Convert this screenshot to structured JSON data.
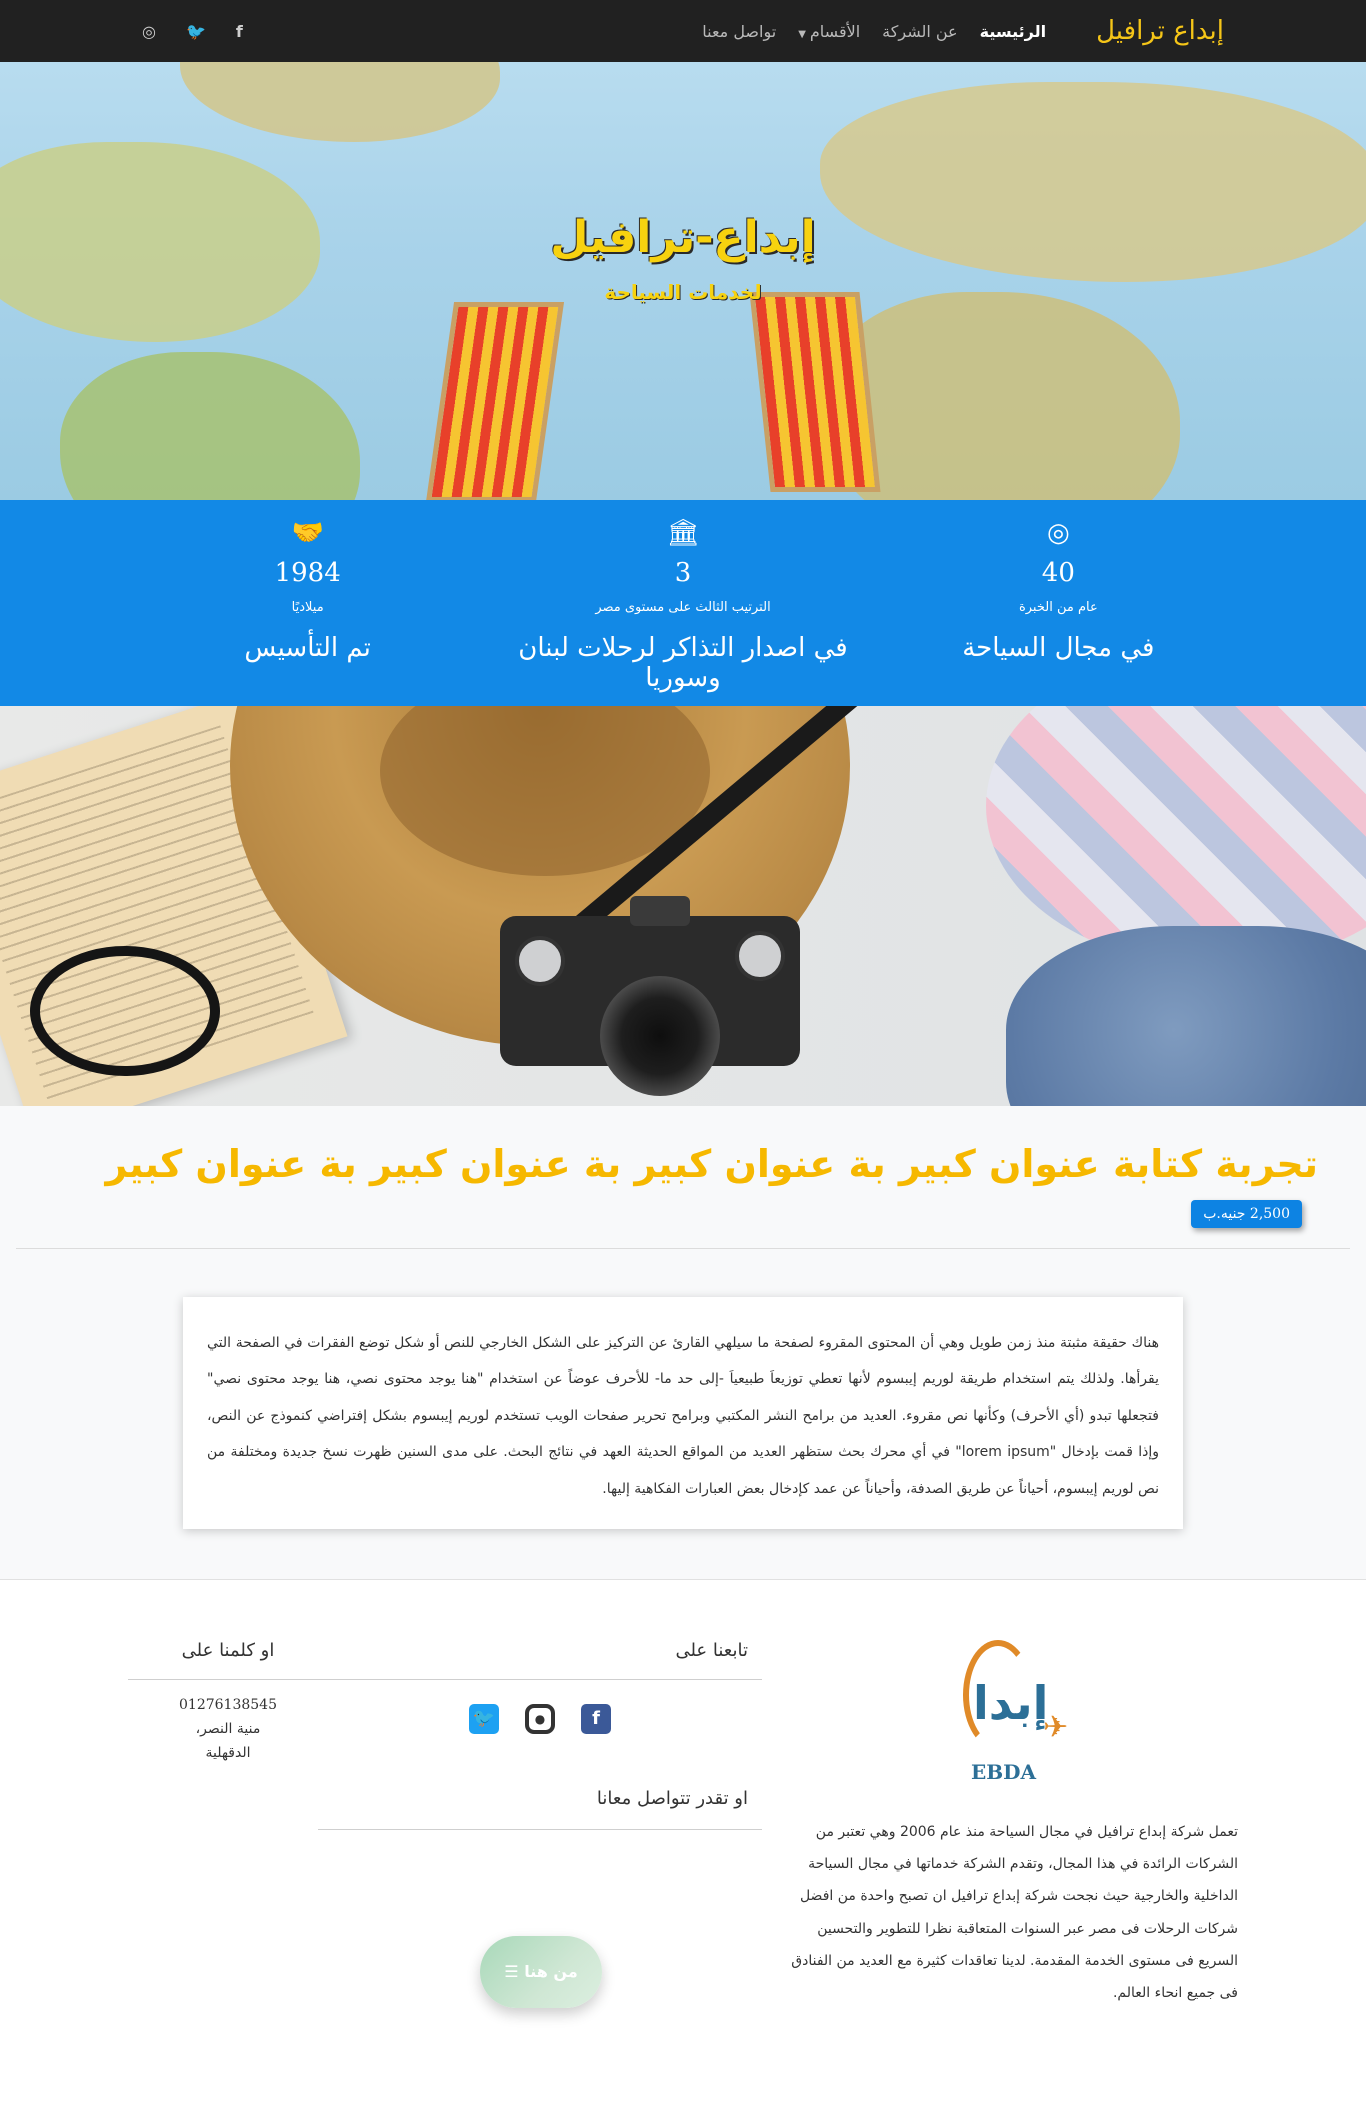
{
  "nav": {
    "brand": "إبداع ترافيل",
    "links": [
      "الرئيسية",
      "عن الشركة",
      "الأقسام",
      "تواصل معنا"
    ],
    "social": {
      "facebook": "f",
      "twitter": "🐦",
      "instagram": "◎"
    }
  },
  "hero": {
    "title": "إبداع-ترافيل",
    "subtitle": "لخدمات السياحة"
  },
  "stats": [
    {
      "icon": "target-icon",
      "number": "40",
      "small": "عام من الخبرة",
      "big": "في مجال السياحة"
    },
    {
      "icon": "bank-icon",
      "number": "3",
      "small": "الترتيب الثالث على مستوى مصر",
      "big": "في اصدار التذاكر لرحلات لبنان وسوريا"
    },
    {
      "icon": "handshake-icon",
      "number": "1984",
      "small": "ميلاديًا",
      "big": "تم التأسيس"
    }
  ],
  "article": {
    "title": "تجربة كتابة عنوان كبير بة عنوان كبير بة عنوان كبير بة عنوان كبير",
    "price": "2,500 جنيه.ب",
    "body": "هناك حقيقة مثبتة منذ زمن طويل وهي أن المحتوى المقروء لصفحة ما سيلهي القارئ عن التركيز على الشكل الخارجي للنص أو شكل توضع الفقرات في الصفحة التي يقرأها. ولذلك يتم استخدام طريقة لوريم إيبسوم لأنها تعطي توزيعاَ طبيعياَ -إلى حد ما- للأحرف عوضاً عن استخدام \"هنا يوجد محتوى نصي، هنا يوجد محتوى نصي\" فتجعلها تبدو (أي الأحرف) وكأنها نص مقروء. العديد من برامح النشر المكتبي وبرامح تحرير صفحات الويب تستخدم لوريم إيبسوم بشكل إفتراضي كنموذج عن النص، وإذا قمت بإدخال \"lorem ipsum\" في أي محرك بحث ستظهر العديد من المواقع الحديثة العهد في نتائج البحث. على مدى السنين ظهرت نسخ جديدة ومختلفة من نص لوريم إيبسوم، أحياناً عن طريق الصدفة، وأحياناً عن عمد كإدخال بعض العبارات الفكاهية إليها."
  },
  "footer": {
    "logo_text": "EBDA",
    "about": "تعمل شركة إبداع ترافيل في مجال السياحة منذ عام 2006 وهي تعتبر من الشركات الرائدة في هذا المجال، وتقدم الشركة خدماتها في مجال السياحة الداخلية والخارجية حيث نجحت شركة إبداع ترافيل ان تصبح واحدة من افضل شركات الرحلات فى مصر عبر السنوات المتعاقبة نظرا للتطوير والتحسين السريع فى مستوى الخدمة المقدمة. لدينا تعاقدات كثيرة مع العديد من الفنادق فى جميع انحاء العالم.",
    "follow_title": "تابعنا على",
    "contact_title": "او تقدر تتواصل معانا",
    "cta": "من هنا ☰",
    "call_title": "او كلمنا على",
    "phone": "01276138545",
    "address1": "منية النصر،",
    "address2": "الدقهلية"
  },
  "colors": {
    "navbar": "#212121",
    "brand": "#f5c518",
    "stats_bg": "#1289e6",
    "title": "#f6b800",
    "badge": "#0d83e3"
  }
}
